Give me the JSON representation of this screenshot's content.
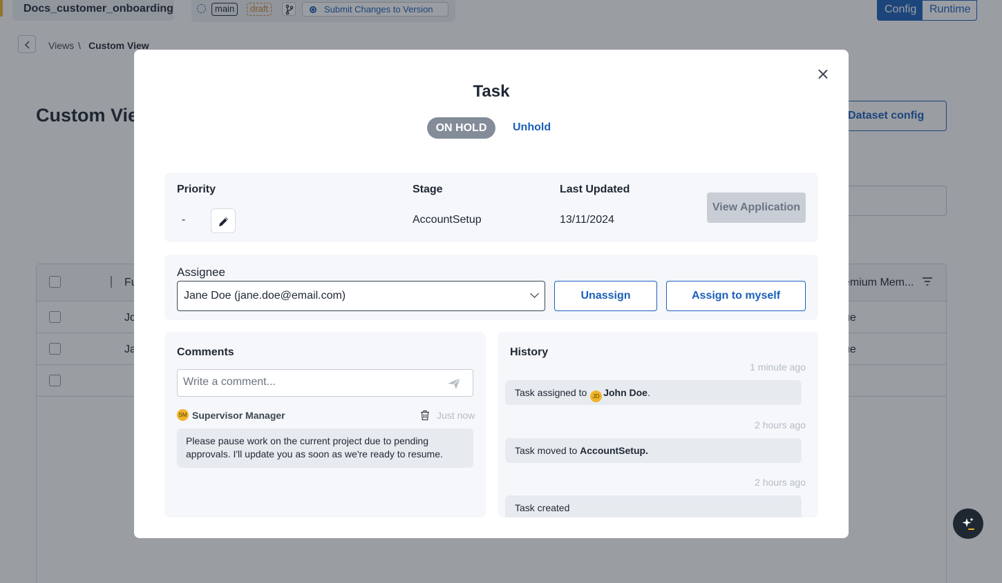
{
  "app": {
    "title": "Docs_customer_onboarding",
    "branch": "main",
    "draft_tag": "draft",
    "submit_label": "Submit Changes to Version",
    "mode_config": "Config",
    "mode_runtime": "Runtime"
  },
  "breadcrumb": {
    "views": "Views",
    "separator": "\\",
    "current": "Custom View"
  },
  "page": {
    "title": "Custom View",
    "dataset_config": "Dataset config"
  },
  "table": {
    "headers": [
      "Fu",
      "emium Mem..."
    ],
    "rows": [
      [
        "Jo",
        "ue"
      ],
      [
        "Ja",
        "ue"
      ]
    ]
  },
  "modal": {
    "title": "Task",
    "status": "ON HOLD",
    "unhold": "Unhold",
    "priority_label": "Priority",
    "priority_value": "-",
    "stage_label": "Stage",
    "stage_value": "AccountSetup",
    "updated_label": "Last Updated",
    "updated_value": "13/11/2024",
    "view_application": "View Application",
    "assignee_label": "Assignee",
    "assignee_value": "Jane Doe (jane.doe@email.com)",
    "unassign": "Unassign",
    "assign_to_myself": "Assign to myself",
    "comments": {
      "title": "Comments",
      "placeholder": "Write a comment...",
      "items": [
        {
          "initials": "SM",
          "author": "Supervisor Manager",
          "time": "Just now",
          "text": "Please pause work on the current project due to pending approvals. I'll update you as soon as we're ready to resume."
        }
      ]
    },
    "history": {
      "title": "History",
      "items": [
        {
          "time": "1 minute ago",
          "prefix": "Task assigned to",
          "initials": "JD",
          "bold": "John Doe",
          "suffix": "."
        },
        {
          "time": "2 hours ago",
          "prefix": "Task moved to",
          "bold": "AccountSetup.",
          "suffix": ""
        },
        {
          "time": "2 hours ago",
          "prefix": "Task created",
          "bold": "",
          "suffix": ""
        }
      ]
    }
  },
  "colors": {
    "primary": "#1b5fb8",
    "status_pill": "#838c98",
    "avatar": "#f0b429"
  }
}
